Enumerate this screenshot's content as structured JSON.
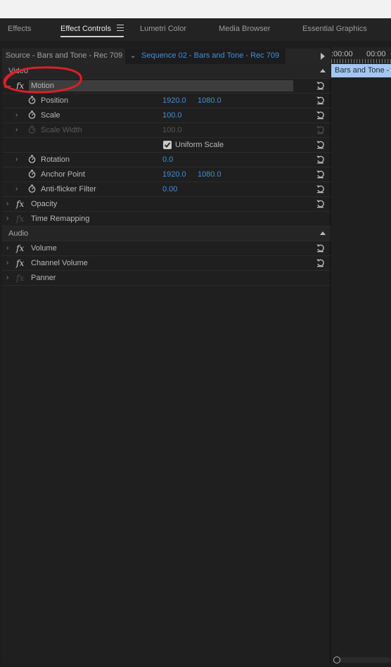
{
  "tabs": [
    "Effects",
    "Effect Controls",
    "Lumetri Color",
    "Media Browser",
    "Essential Graphics"
  ],
  "active_tab": "Effect Controls",
  "clip_bar": {
    "source_label": "Source - Bars and Tone - Rec 709",
    "sequence_label": "Sequence 02 - Bars and Tone - Rec 709"
  },
  "sections": {
    "video": "Video",
    "audio": "Audio"
  },
  "effects": {
    "motion": "Motion",
    "opacity": "Opacity",
    "time_remapping": "Time Remapping",
    "volume": "Volume",
    "channel_volume": "Channel Volume",
    "panner": "Panner"
  },
  "fx_label": "fx",
  "properties": {
    "position": {
      "label": "Position",
      "x": "1920.0",
      "y": "1080.0"
    },
    "scale": {
      "label": "Scale",
      "value": "100.0"
    },
    "scale_width": {
      "label": "Scale Width",
      "value": "100.0"
    },
    "uniform_scale": {
      "label": "Uniform Scale",
      "checked": true
    },
    "rotation": {
      "label": "Rotation",
      "value": "0.0"
    },
    "anchor_point": {
      "label": "Anchor Point",
      "x": "1920.0",
      "y": "1080.0"
    },
    "anti_flicker": {
      "label": "Anti-flicker Filter",
      "value": "0.00"
    }
  },
  "timeline": {
    "timecodes": [
      ":00:00",
      "00:00"
    ],
    "clip_label": "Bars and Tone -"
  },
  "colors": {
    "value_blue": "#3f8fdc",
    "clip_fill": "#a4c6ef",
    "annotation_red": "#d9202a"
  }
}
